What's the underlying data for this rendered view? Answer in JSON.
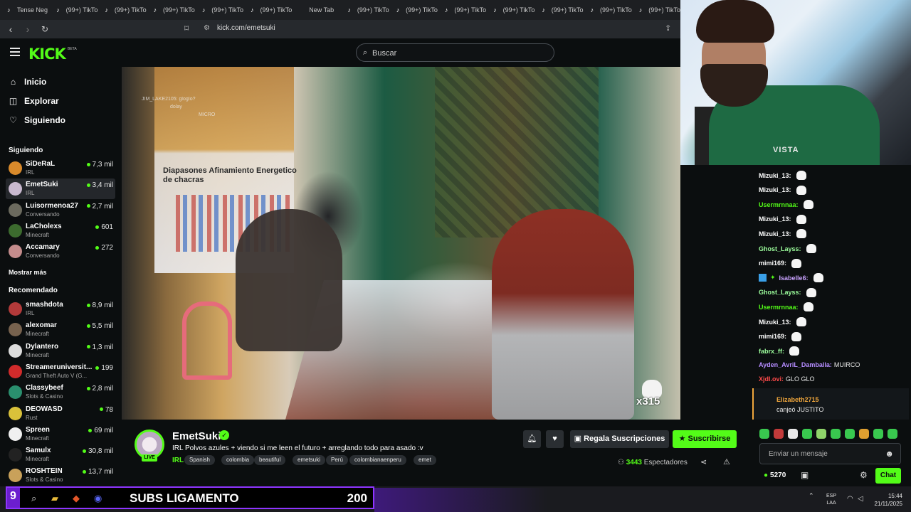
{
  "browser": {
    "tabs": [
      "Tense Neg",
      "(99+) TikTo",
      "(99+) TikTo",
      "(99+) TikTo",
      "(99+) TikTo",
      "(99+) TikTo",
      "New Tab",
      "(99+) TikTo",
      "(99+) TikTo",
      "(99+) TikTo",
      "(99+) TikTo",
      "(99+) TikTo",
      "(99+) TikTo",
      "(99+) TikTo"
    ],
    "url": "kick.com/emetsuki"
  },
  "header": {
    "logo": "KICK",
    "logo_badge": "BETA",
    "search_placeholder": "Buscar"
  },
  "sidebar": {
    "nav": [
      {
        "label": "Inicio",
        "icon": "home-icon"
      },
      {
        "label": "Explorar",
        "icon": "compass-icon"
      },
      {
        "label": "Siguiendo",
        "icon": "heart-icon"
      }
    ],
    "following_title": "Siguiendo",
    "following": [
      {
        "name": "SiDeRaL",
        "category": "IRL",
        "viewers": "7,3 mil",
        "color": "#d98a2b"
      },
      {
        "name": "EmetSuki",
        "category": "IRL",
        "viewers": "3,4 mil",
        "color": "#c9b9cf"
      },
      {
        "name": "Luisormenoa27",
        "category": "Conversando",
        "viewers": "2,7 mil",
        "color": "#6b6a5e"
      },
      {
        "name": "LaCholexs",
        "category": "Minecraft",
        "viewers": "601",
        "color": "#3c6b2e"
      },
      {
        "name": "Accamary",
        "category": "Conversando",
        "viewers": "272",
        "color": "#c48c8c"
      }
    ],
    "show_more": "Mostrar más",
    "recommended_title": "Recomendado",
    "recommended": [
      {
        "name": "smashdota",
        "category": "IRL",
        "viewers": "8,9 mil",
        "color": "#b33a3a"
      },
      {
        "name": "alexomar",
        "category": "Minecraft",
        "viewers": "5,5 mil",
        "color": "#77624e"
      },
      {
        "name": "Dylantero",
        "category": "Minecraft",
        "viewers": "1,3 mil",
        "color": "#ddd"
      },
      {
        "name": "Streameruniversit...",
        "category": "Grand Theft Auto V (G...",
        "viewers": "199",
        "color": "#d12b2b"
      },
      {
        "name": "Classybeef",
        "category": "Slots & Casino",
        "viewers": "2,8 mil",
        "color": "#2a8f6e"
      },
      {
        "name": "DEOWASD",
        "category": "Rust",
        "viewers": "78",
        "color": "#d9c13a"
      },
      {
        "name": "Spreen",
        "category": "Minecraft",
        "viewers": "69 mil",
        "color": "#f0f0f0"
      },
      {
        "name": "Samulx",
        "category": "Minecraft",
        "viewers": "30,8 mil",
        "color": "#222"
      },
      {
        "name": "ROSHTEIN",
        "category": "Slots & Casino",
        "viewers": "13,7 mil",
        "color": "#c9a15a"
      }
    ]
  },
  "video": {
    "poster_text": "Diapasones Afinamiento Energetico de chacras",
    "overlay_chat": [
      "JIM_LAKE2105: glogIo?",
      "dolay",
      "MICRO"
    ],
    "badge_multiplier": "x315",
    "webcam_jersey_text": "VISTA"
  },
  "stream": {
    "channel": "EmetSuki",
    "live_label": "LIVE",
    "title": "IRL Polvos azules + viendo si me leen el futuro + arreglando todo para asado :v",
    "category": "IRL",
    "tags": [
      "Spanish",
      "colombia",
      "beautiful",
      "emetsuki",
      "Perú",
      "colombianaenperu",
      "emet"
    ],
    "gift_label": "Regala Suscripciones",
    "subscribe_label": "Suscribirse",
    "viewers_count": "3443",
    "viewers_label": "Espectadores"
  },
  "chat": {
    "messages": [
      {
        "user": "Mizuki_13:",
        "color": "#ffffff",
        "text": ""
      },
      {
        "user": "Mizuki_13:",
        "color": "#ffffff",
        "text": ""
      },
      {
        "user": "Usermrnnaa:",
        "color": "#53fc18",
        "text": ""
      },
      {
        "user": "Mizuki_13:",
        "color": "#ffffff",
        "text": ""
      },
      {
        "user": "Mizuki_13:",
        "color": "#ffffff",
        "text": ""
      },
      {
        "user": "Ghost_Layss:",
        "color": "#9dff9d",
        "text": ""
      },
      {
        "user": "mimi169:",
        "color": "#ffffff",
        "text": ""
      },
      {
        "user": "Isabelle6:",
        "color": "#c9a2ff",
        "text": ""
      },
      {
        "user": "Ghost_Layss:",
        "color": "#9dff9d",
        "text": ""
      },
      {
        "user": "Usermrnnaa:",
        "color": "#53fc18",
        "text": ""
      },
      {
        "user": "Mizuki_13:",
        "color": "#ffffff",
        "text": ""
      },
      {
        "user": "mimi169:",
        "color": "#ffffff",
        "text": ""
      },
      {
        "user": "fabrx_ff:",
        "color": "#9dff9d",
        "text": ""
      },
      {
        "user": "Ayden_AvriL_Damballa:",
        "color": "#b58cff",
        "text": "MUIRCO"
      },
      {
        "user": "Xjdl.ovi:",
        "color": "#ff4a4a",
        "text": "GLO GLO"
      }
    ],
    "redeem_user": "Elizabeth2715",
    "redeem_text": "canjeó JUSTITO",
    "input_placeholder": "Enviar un mensaje",
    "points": "5270",
    "send_label": "Chat"
  },
  "taskbar": {
    "subs_goal_number": "9",
    "subs_goal_label": "SUBS LIGAMENTO",
    "subs_goal_count": "200",
    "lang_top": "ESP",
    "lang_bottom": "LAA",
    "time": "15:44",
    "date": "21/11/2025"
  }
}
